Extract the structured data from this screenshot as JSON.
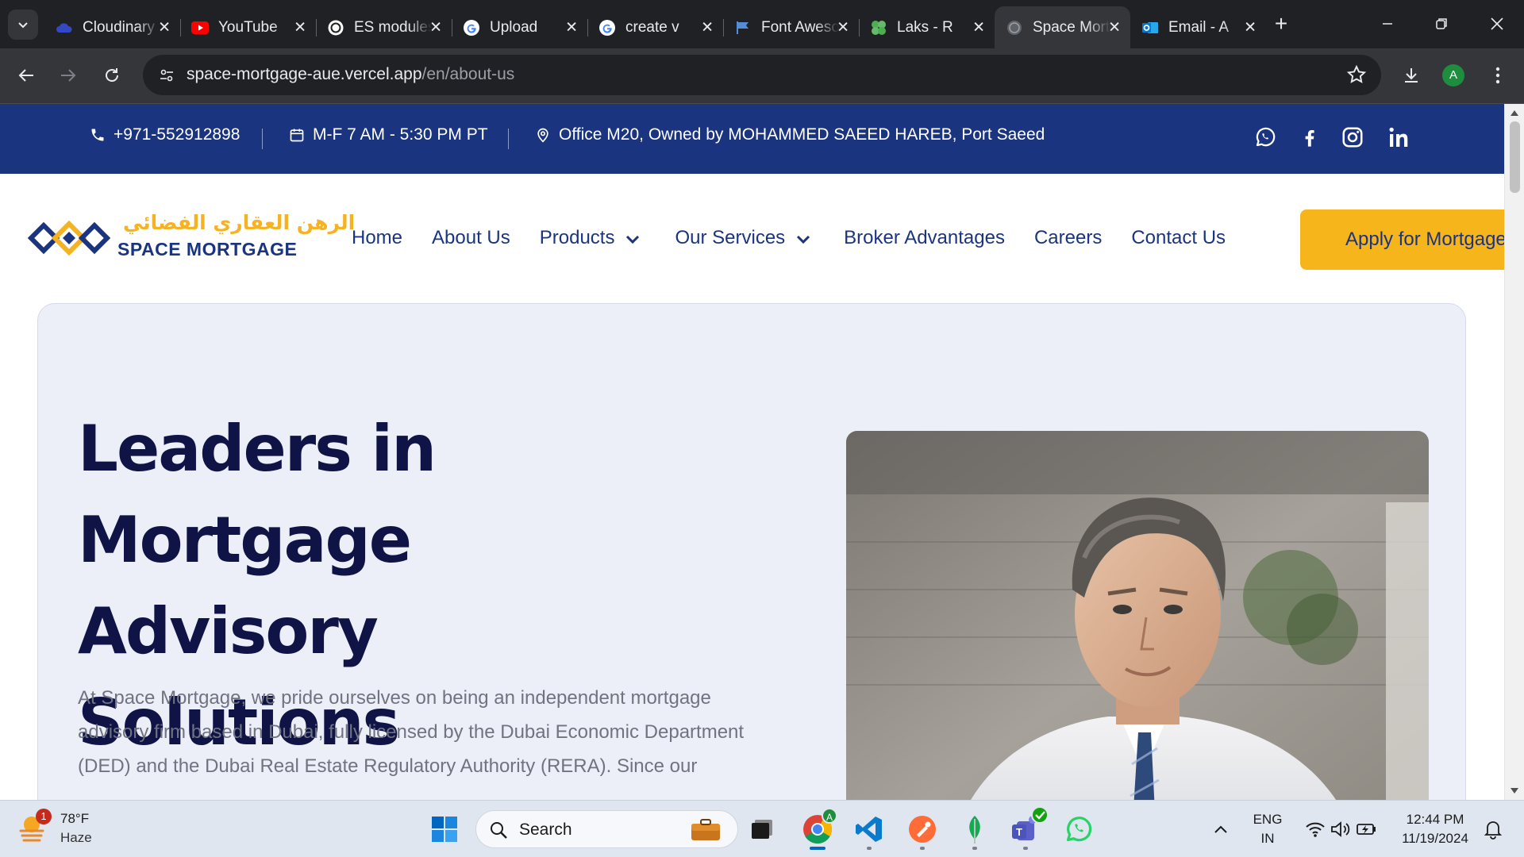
{
  "browser": {
    "tabs": [
      {
        "title": "Cloudinary",
        "favicon": "cloudinary-icon",
        "color": "#3448c5"
      },
      {
        "title": "YouTube",
        "favicon": "youtube-icon",
        "color": "#ff0000"
      },
      {
        "title": "ES modules",
        "favicon": "chatgpt-icon",
        "color": "#ffffff"
      },
      {
        "title": "Upload",
        "favicon": "google-icon",
        "color": "#ffffff"
      },
      {
        "title": "create v",
        "favicon": "google-icon",
        "color": "#ffffff"
      },
      {
        "title": "Font Awesome",
        "favicon": "font-awesome-flag-icon",
        "color": "#538dd7"
      },
      {
        "title": "Laks - R",
        "favicon": "clover-icon",
        "color": "#4caf50"
      },
      {
        "title": "Space Mortgage",
        "favicon": "globe-icon",
        "color": "#9aa0a6",
        "active": true
      },
      {
        "title": "Email - A",
        "favicon": "outlook-icon",
        "color": "#0078d4"
      }
    ],
    "url_host": "space-mortgage-aue.vercel.app",
    "url_path": "/en/about-us",
    "profile_initial": "A"
  },
  "site": {
    "topbar": {
      "phone": "+971-552912898",
      "hours": "M-F 7 AM - 5:30 PM PT",
      "address": "Office M20, Owned by MOHAMMED SAEED HAREB, Port Saeed",
      "socials": [
        "whatsapp-icon",
        "facebook-icon",
        "instagram-icon",
        "linkedin-icon"
      ]
    },
    "logo": {
      "arabic": "الرهن العقاري الفضائي",
      "english": "SPACE MORTGAGE",
      "colors": {
        "primary": "#1b347f",
        "accent": "#f5b324"
      }
    },
    "nav": {
      "items": [
        {
          "label": "Home",
          "dropdown": false
        },
        {
          "label": "About Us",
          "dropdown": false
        },
        {
          "label": "Products",
          "dropdown": true
        },
        {
          "label": "Our Services",
          "dropdown": true
        },
        {
          "label": "Broker Advantages",
          "dropdown": false
        },
        {
          "label": "Careers",
          "dropdown": false
        },
        {
          "label": "Contact Us",
          "dropdown": false
        }
      ],
      "cta": "Apply for Mortgage"
    },
    "hero": {
      "title_lines": [
        "Leaders in",
        "Mortgage Advisory",
        "Solutions"
      ],
      "paragraph": "At Space Mortgage, we pride ourselves on being an independent mortgage advisory firm based in Dubai, fully licensed by the Dubai Economic Department (DED) and the Dubai Real Estate Regulatory Authority (RERA). Since our"
    }
  },
  "taskbar": {
    "weather": {
      "temp": "78°F",
      "condition": "Haze",
      "badge": "1"
    },
    "search_placeholder": "Search",
    "apps": [
      "windows-start-icon",
      "briefcase-icon",
      "task-view-icon",
      "chrome-icon",
      "vscode-icon",
      "postman-icon",
      "mongodb-icon",
      "teams-icon",
      "whatsapp-icon"
    ],
    "language": {
      "line1": "ENG",
      "line2": "IN"
    },
    "clock": {
      "time": "12:44 PM",
      "date": "11/19/2024"
    }
  }
}
